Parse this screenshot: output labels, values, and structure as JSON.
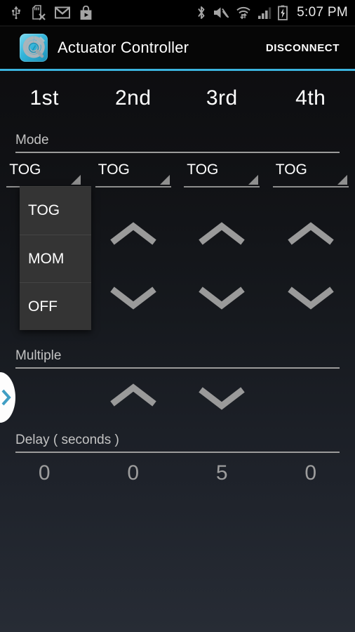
{
  "status_bar": {
    "time": "5:07 PM",
    "left_icons": [
      "usb-icon",
      "sdcard-removed-icon",
      "gmail-icon",
      "play-store-icon"
    ],
    "right_icons": [
      "bluetooth-icon",
      "volume-muted-icon",
      "wifi-icon",
      "cellular-signal-icon",
      "battery-charging-icon"
    ]
  },
  "action_bar": {
    "app_icon": "actuator-controller-app-icon",
    "title": "Actuator Controller",
    "disconnect_label": "DISCONNECT",
    "accent_color": "#3bb4de"
  },
  "columns": [
    {
      "header": "1st"
    },
    {
      "header": "2nd"
    },
    {
      "header": "3rd"
    },
    {
      "header": "4th"
    }
  ],
  "mode_section": {
    "label": "Mode",
    "spinners": [
      {
        "value": "TOG"
      },
      {
        "value": "TOG"
      },
      {
        "value": "TOG"
      },
      {
        "value": "TOG"
      }
    ]
  },
  "dropdown": {
    "open": true,
    "owner_column": "1st",
    "options": [
      {
        "label": "TOG"
      },
      {
        "label": "MOM"
      },
      {
        "label": "OFF"
      }
    ]
  },
  "multiple_section": {
    "label": "Multiple",
    "up_label": "chevron-up-icon",
    "down_label": "chevron-down-icon"
  },
  "delay_section": {
    "label": "Delay ( seconds )",
    "values": [
      "0",
      "0",
      "5",
      "0"
    ]
  },
  "drawer_handle": {
    "icon": "chevron-right-icon",
    "color": "#3f9ec4"
  }
}
